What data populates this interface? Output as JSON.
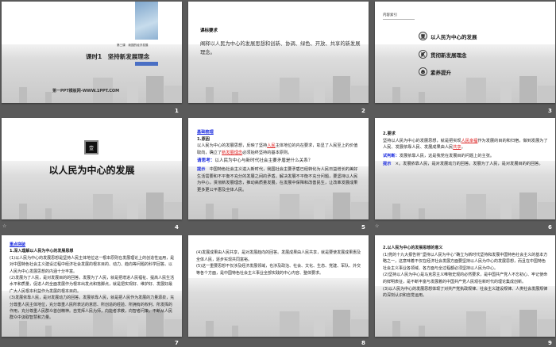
{
  "slides": [
    {
      "number": "1",
      "subtitle": "第三课　我国的经济发展",
      "title": "课时1　坚持新发展理念",
      "watermark": "第一PPT模板网-WWW.1PPT.COM"
    },
    {
      "number": "2",
      "heading": "课标要求",
      "body": "阐释以人民为中心的发展思想和创新、协调、绿色、开放、共享的新发展理念。"
    },
    {
      "number": "3",
      "heading": "内容索引",
      "items": [
        {
          "badge": "壹",
          "label": "以人民为中心的发展"
        },
        {
          "badge": "贰",
          "label": "贯彻新发展理念"
        },
        {
          "badge": "叁",
          "label": "素养提升"
        }
      ]
    },
    {
      "number": "4",
      "badge": "壹",
      "title": "以人民为中心的发展"
    },
    {
      "number": "5",
      "section": "基础梳理",
      "heading": "1.原因",
      "p1a": "以人民为中心的发展思想，反映了坚持",
      "p1b": "人民",
      "p1c": "主体地位的内在要求，彰显了人民至上的价值取向，确立了",
      "p1d": "新发展理念",
      "p1e": "必须始终坚持的基本原则。",
      "q_label": "请思考：",
      "q": "以人民为中心与新时代社会主要矛盾是什么关系？",
      "hint_label": "提示",
      "hint": "中国特色社会主义进入新时代，我国社会主要矛盾已经转化为人民日益增长的美好生活需要和不平衡不充分的发展之间的矛盾。解决发展不平衡不充分问题，要坚持以人民为中心，贯彻新发展理念，推动高质量发展，在发展中保障和改善民生，让改革发展成果更多更公平惠及全体人民。"
    },
    {
      "number": "6",
      "heading": "2.要求",
      "p1a": "坚持以人民为中心的发展思想，就是把实现",
      "p1b": "人民幸福",
      "p1c": "作为发展的目的和归宿，做到发展为了人民、发展依靠人民、发展成果由人民",
      "p1d": "共享",
      "p1e": "。",
      "q_label": "试判断：",
      "q": "发展依靠人民，这是我党在发展目的问题上的主张。",
      "hint_label": "提示",
      "hint": "×。发展依靠人民，是对发展动力的回答。发展为了人民，是对发展目的的回答。"
    },
    {
      "number": "7",
      "section": "重点突破",
      "heading": "1.深入理解以人民为中心的发展思想",
      "paras": [
        "(1)以人民为中心的发展思想是坚持人民主体地位这一根本原则在发展理论上的创造性运用，是对中国特色社会主义建设过程中经济社会发展的根本目的、动力、趋向等问题的科学回答。以人民为中心发展思想的内涵十分丰富。",
        "(2)发展为了人民，是对发展目的的回答。发展为了人民，就是把增进人民福祉、提高人民生活水平和质量，促进人的全面发展作为根本出发点和落脚点，就是把实现好、维护好、发展好最广大人民根本利益作为发展的根本目的。",
        "(3)发展依靠人民，是对发展动力的回答。发展依靠人民，就是把人民作为发展的力量源泉，充分尊重人民主体地位，充分尊重人民所表达的意愿、所创造的经验、所拥有的权利、所发挥的作用，充分尊重人民群众首创精神。自觉拜人民为师，向能者求教，向智者问策，不断从人民群众中汲取智慧和力量。"
      ]
    },
    {
      "number": "8",
      "paras": [
        "(4)发展成果由人民共享，是对发展趋向的回答。发展成果由人民共享，就是要使发展成果惠及全体人民，逐步实现共同富裕。",
        "(5)这一重要思想不仅涉及经济发展领域，也涉及政治、社会、文化、生态、党建、军队、外交等各个方面，是中国特色社会主义事业全部实践的中心内容、整体要求。"
      ]
    },
    {
      "number": "9",
      "heading": "2.以人民为中心的发展思想的意义",
      "paras": [
        "(1)党的十九大报告将“坚持以人民为中心”确立为新时代坚持和发展中国特色社会主义的基本方略之一，这意味着不仅在经济社会发展方面要坚持以人民为中心的发展思想，而且在中国特色社会主义事业各领域、各方面与全过程都必须坚持以人民为中心。",
        "(2)坚持以人民为中心是马克思主义唯物史观的必然要求，是中国共产党人不忘初心、牢记使命的鲜明表征，是不断丰富与发展着的中国共产党人民观在新时代的理论集成创新。",
        "(3)以人民为中心的发展思想体现了对共产党执政规律、社会主义建设规律、人类社会发展规律的深刻认识和自觉运用。"
      ]
    }
  ],
  "colors": {
    "background": "#5a5a5a",
    "accent_blue": "#2030e0",
    "accent_red": "#d22222",
    "title_bar": "#4a6fc4"
  }
}
